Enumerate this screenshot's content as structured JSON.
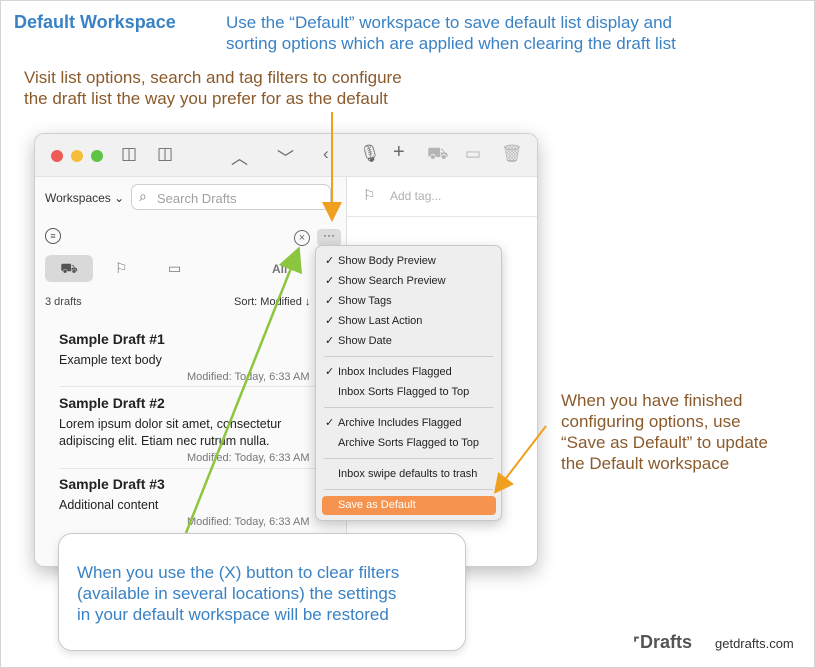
{
  "heading": "Default Workspace",
  "notes": {
    "top_right": [
      "Use the “Default” workspace to save default list display and",
      "sorting options which are applied when clearing the draft list"
    ],
    "top_left": [
      "Visit list options, search and tag filters to configure",
      "the draft list the way you prefer for as the default"
    ],
    "right": [
      "When you have finished",
      "configuring options, use",
      "“Save as Default” to update",
      "the Default workspace"
    ],
    "callout": [
      "When you use the (X) button to clear filters",
      "(available in several locations) the settings",
      "in your default workspace will be restored"
    ]
  },
  "window": {
    "workspaces_label": "Workspaces",
    "search_placeholder": "Search Drafts",
    "filter_all": "All",
    "count": "3 drafts",
    "sort": "Sort: Modified ↓",
    "add_tag": "Add tag...",
    "drafts": [
      {
        "title": "Sample Draft #1",
        "body": "Example text body",
        "modified": "Modified: Today, 6:33 AM"
      },
      {
        "title": "Sample Draft #2",
        "body": "Lorem ipsum dolor sit amet, consectetur adipiscing elit. Etiam nec rutrum nulla.",
        "modified": "Modified: Today, 6:33 AM"
      },
      {
        "title": "Sample Draft #3",
        "body": "Additional content",
        "modified": "Modified: Today, 6:33 AM"
      }
    ]
  },
  "menu": {
    "groups": [
      [
        {
          "label": "Show Body Preview",
          "checked": true
        },
        {
          "label": "Show Search Preview",
          "checked": true
        },
        {
          "label": "Show Tags",
          "checked": true
        },
        {
          "label": "Show Last Action",
          "checked": true
        },
        {
          "label": "Show Date",
          "checked": true
        }
      ],
      [
        {
          "label": "Inbox Includes Flagged",
          "checked": true
        },
        {
          "label": "Inbox Sorts Flagged to Top",
          "checked": false
        }
      ],
      [
        {
          "label": "Archive Includes Flagged",
          "checked": true
        },
        {
          "label": "Archive Sorts Flagged to Top",
          "checked": false
        }
      ],
      [
        {
          "label": "Inbox swipe defaults to trash",
          "checked": false
        }
      ]
    ],
    "save": "Save as Default"
  },
  "brand": {
    "name": "Drafts",
    "url": "getdrafts.com"
  },
  "colors": {
    "blue": "#3a82c4",
    "brown": "#8b5a2b",
    "orange": "#f0a020",
    "green": "#8cc63f",
    "highlight": "#f5934f"
  }
}
